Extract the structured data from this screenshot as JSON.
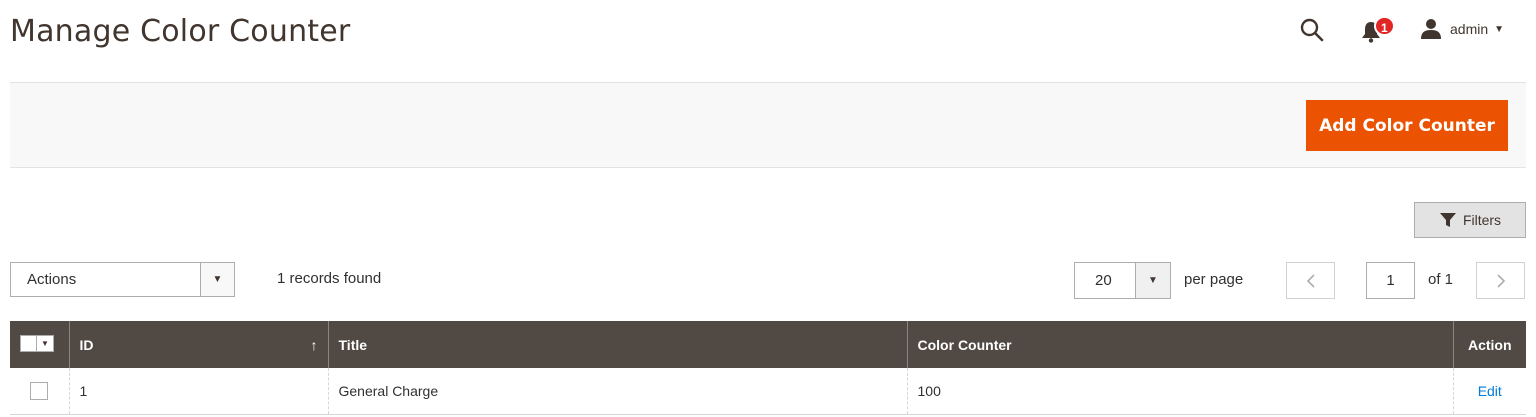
{
  "page": {
    "title": "Manage Color Counter"
  },
  "header": {
    "search_icon": "search-icon",
    "notifications": {
      "icon": "bell-icon",
      "count": "1"
    },
    "user": {
      "icon": "user-icon",
      "name": "admin"
    }
  },
  "action_bar": {
    "add_button_label": "Add Color Counter",
    "accent_color": "#eb5202"
  },
  "toolbar": {
    "filters_label": "Filters",
    "actions_label": "Actions",
    "records_found": "1 records found",
    "per_page_value": "20",
    "per_page_label": "per page",
    "current_page": "1",
    "total_pages_label": "of 1"
  },
  "grid": {
    "columns": [
      "ID",
      "Title",
      "Color Counter",
      "Action"
    ],
    "sort_indicator": "↑",
    "rows": [
      {
        "id": "1",
        "title": "General Charge",
        "color_counter": "100",
        "action": "Edit"
      }
    ],
    "header_color": "#514943"
  }
}
